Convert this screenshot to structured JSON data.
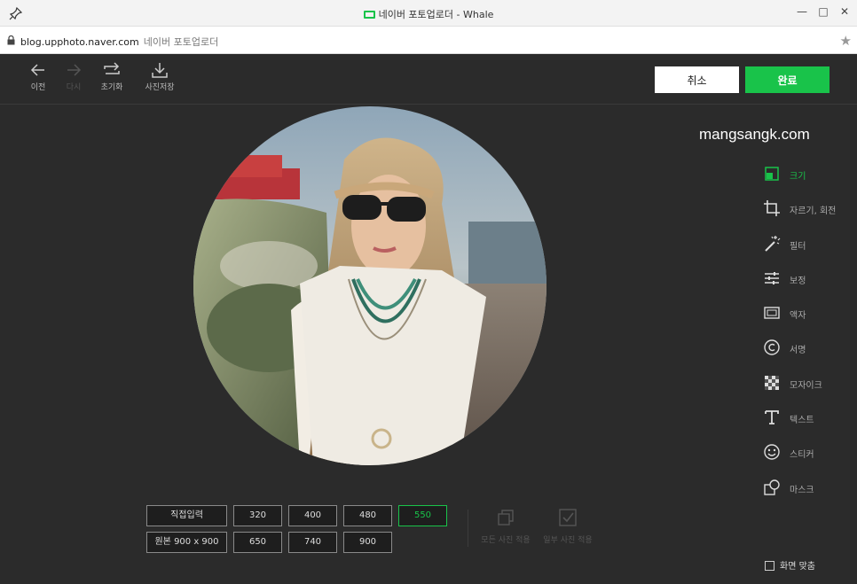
{
  "browser": {
    "window_title": "네이버 포토업로더 - Whale",
    "url_host": "blog.upphoto.naver.com",
    "url_title": "네이버 포토업로더"
  },
  "toolbar": {
    "undo_label": "이전",
    "redo_label": "다시",
    "reset_label": "초기화",
    "save_label": "사진저장",
    "cancel_label": "취소",
    "done_label": "완료"
  },
  "watermark": "mangsangk.com",
  "menu": {
    "items": [
      {
        "label": "크기",
        "icon": "resize-icon",
        "active": true
      },
      {
        "label": "자르기, 회전",
        "icon": "crop-icon"
      },
      {
        "label": "필터",
        "icon": "magic-wand-icon"
      },
      {
        "label": "보정",
        "icon": "sliders-icon"
      },
      {
        "label": "액자",
        "icon": "frame-icon"
      },
      {
        "label": "서명",
        "icon": "copyright-icon"
      },
      {
        "label": "모자이크",
        "icon": "mosaic-icon"
      },
      {
        "label": "텍스트",
        "icon": "text-icon"
      },
      {
        "label": "스티커",
        "icon": "smiley-icon"
      },
      {
        "label": "마스크",
        "icon": "mask-icon"
      }
    ]
  },
  "sizes": {
    "custom_label": "직접입력",
    "original_label": "원본 900 x 900",
    "options": [
      "320",
      "400",
      "480",
      "550",
      "650",
      "740",
      "900"
    ],
    "selected": "550"
  },
  "apply": {
    "all_label": "모든 사진 적용",
    "some_label": "일부 사진 적용"
  },
  "fit_label": "화면 맞춤",
  "colors": {
    "accent": "#19c34a",
    "background": "#2b2b2b"
  }
}
